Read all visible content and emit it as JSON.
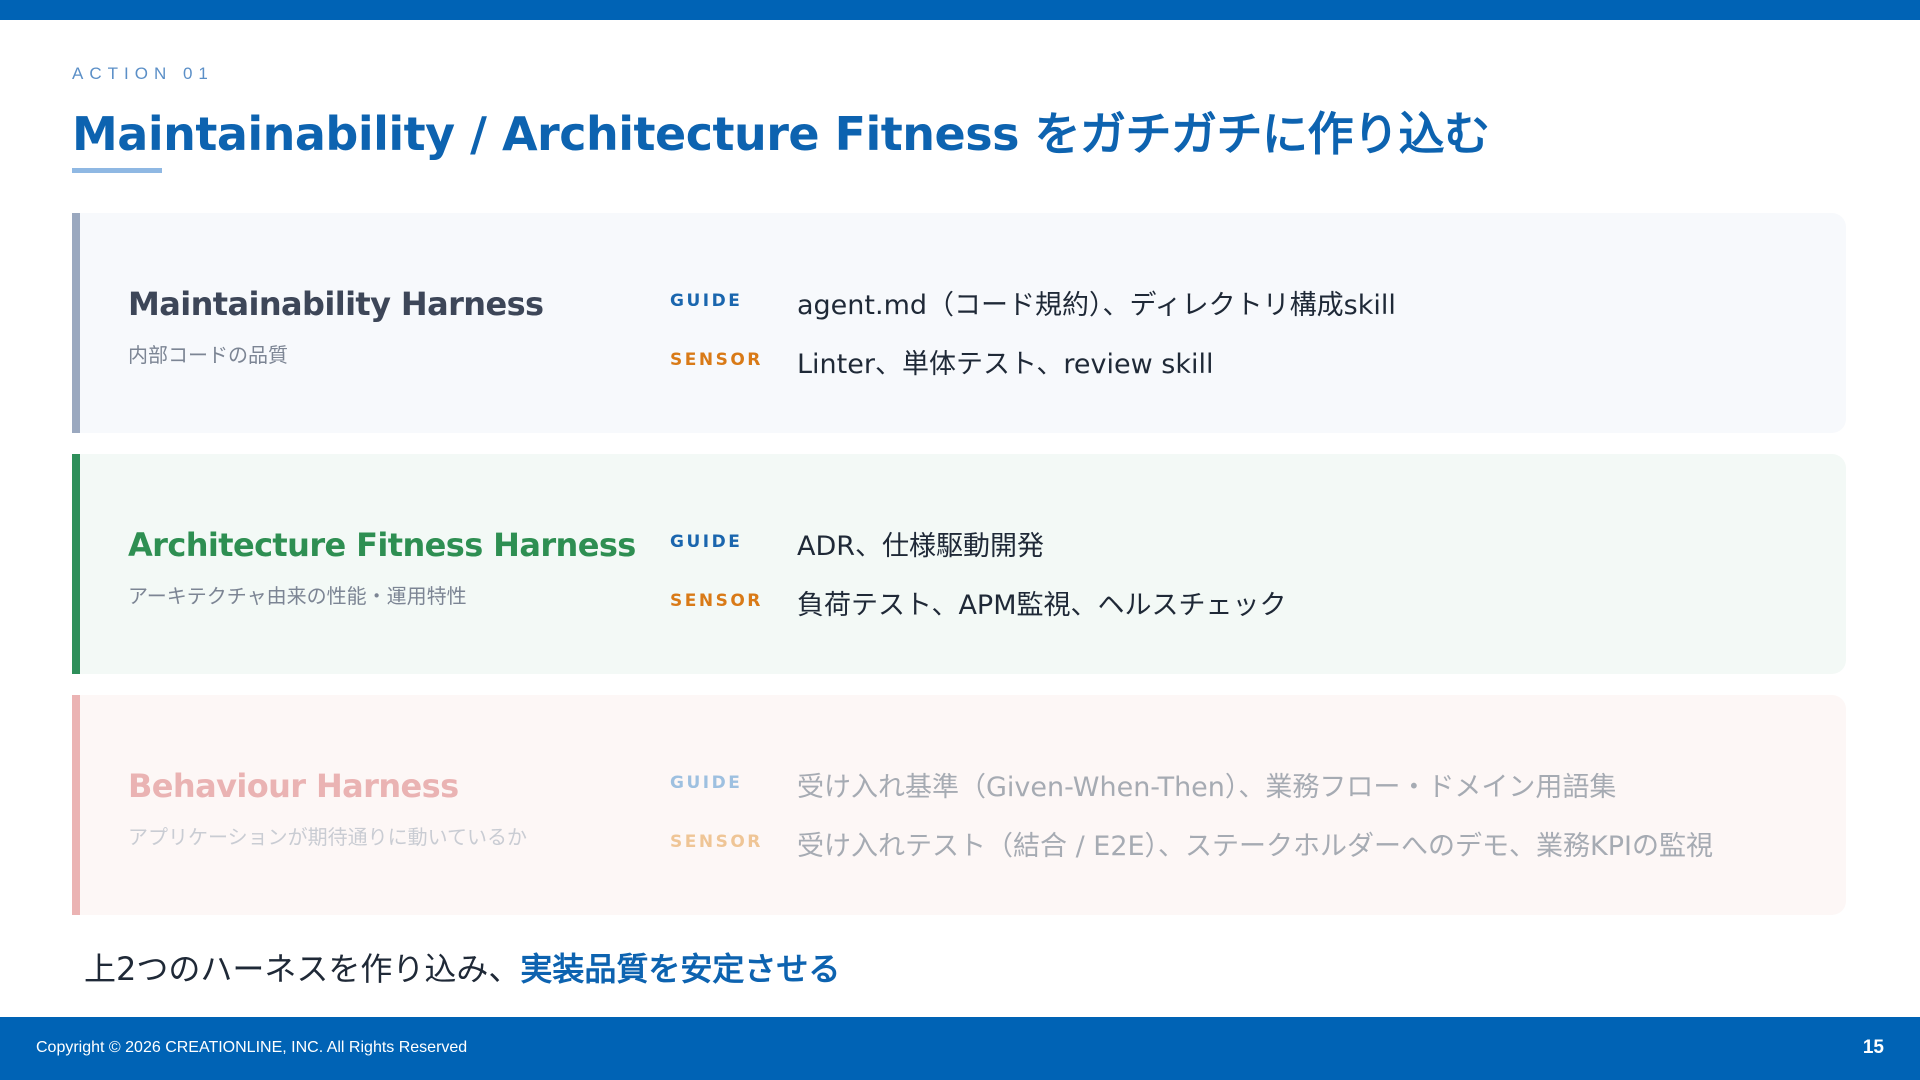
{
  "slide": {
    "eyebrow": "ACTION 01",
    "title": "Maintainability / Architecture Fitness をガチガチに作り込む"
  },
  "cards": [
    {
      "name": "Maintainability Harness",
      "subtitle": "内部コードの品質",
      "guide_label": "GUIDE",
      "guide_text": "agent.md（コード規約）、ディレクトリ構成skill",
      "sensor_label": "SENSOR",
      "sensor_text": "Linter、単体テスト、review skill",
      "accent_color": "#9aa8bf"
    },
    {
      "name": "Architecture Fitness Harness",
      "subtitle": "アーキテクチャ由来の性能・運用特性",
      "guide_label": "GUIDE",
      "guide_text": "ADR、仕様駆動開発",
      "sensor_label": "SENSOR",
      "sensor_text": "負荷テスト、APM監視、ヘルスチェック",
      "accent_color": "#2e8f5a"
    },
    {
      "name": "Behaviour Harness",
      "subtitle": "アプリケーションが期待通りに動いているか",
      "guide_label": "GUIDE",
      "guide_text": "受け入れ基準（Given-When-Then）、業務フロー・ドメイン用語集",
      "sensor_label": "SENSOR",
      "sensor_text": "受け入れテスト（結合 / E2E）、ステークホルダーへのデモ、業務KPIの監視",
      "accent_color": "#ebb3b3"
    }
  ],
  "conclusion": {
    "prefix": "上2つのハーネスを作り込み、",
    "emphasis": "実装品質を安定させる"
  },
  "footer": {
    "copyright": "Copyright © 2026 CREATIONLINE, INC. All Rights Reserved",
    "page_number": "15"
  },
  "colors": {
    "brand_blue": "#0063b5",
    "guide_blue": "#1a66ae",
    "sensor_orange": "#d97a17"
  }
}
